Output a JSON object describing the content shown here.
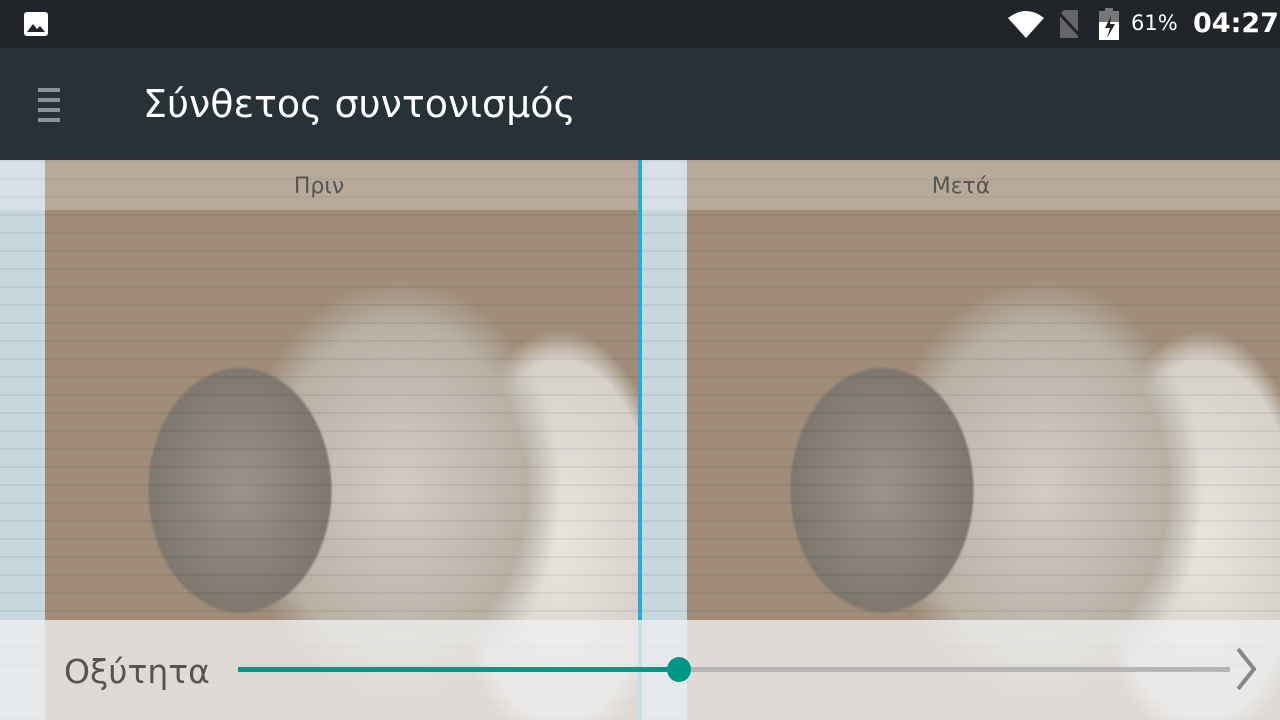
{
  "status_bar": {
    "battery": "61%",
    "time": "04:27",
    "icons": [
      "image-icon",
      "wifi-icon",
      "no-sim-icon",
      "battery-charging-icon"
    ]
  },
  "app_bar": {
    "title": "Σύνθετος συντονισμός",
    "menu_icon": "menu-icon"
  },
  "preview": {
    "before_label": "Πριν",
    "after_label": "Μετά"
  },
  "control": {
    "label": "Οξύτητα",
    "value": 0.445,
    "next_icon": "chevron-right-icon",
    "accent": "#009688"
  }
}
